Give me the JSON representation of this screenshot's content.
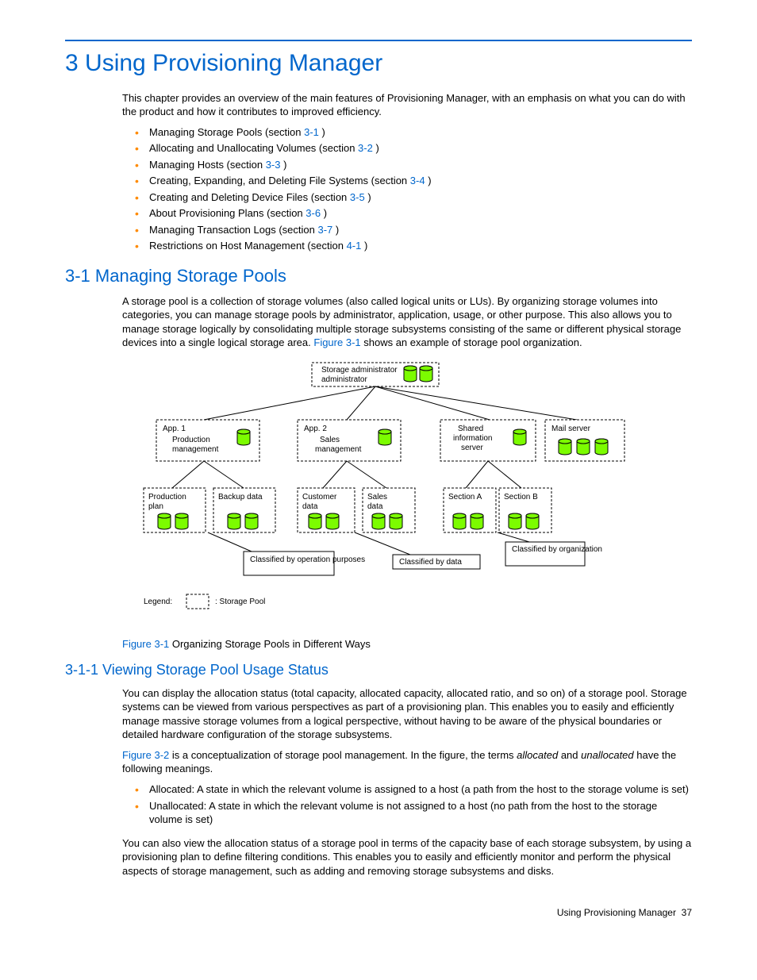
{
  "chapter": {
    "number": "3",
    "title": "Using Provisioning Manager"
  },
  "intro": "This chapter provides an overview of the main features of Provisioning Manager, with an emphasis on what you can do with the product and how it contributes to improved efficiency.",
  "toc": [
    {
      "text": "Managing Storage Pools (section ",
      "ref": "3-1",
      "tail": " )"
    },
    {
      "text": "Allocating and Unallocating Volumes (section ",
      "ref": "3-2",
      "tail": " )"
    },
    {
      "text": "Managing Hosts (section ",
      "ref": "3-3",
      "tail": " )"
    },
    {
      "text": "Creating, Expanding, and Deleting File Systems (section ",
      "ref": "3-4",
      "tail": " )"
    },
    {
      "text": "Creating and Deleting Device Files (section ",
      "ref": "3-5",
      "tail": " )"
    },
    {
      "text": "About Provisioning Plans (section ",
      "ref": "3-6",
      "tail": " )"
    },
    {
      "text": "Managing Transaction Logs (section ",
      "ref": "3-7",
      "tail": " )"
    },
    {
      "text": "Restrictions on Host Management (section ",
      "ref": "4-1",
      "tail": " )"
    }
  ],
  "s31": {
    "heading": "3-1 Managing Storage Pools",
    "p1a": "A storage pool is a collection of storage volumes (also called logical units or LUs). By organizing storage volumes into categories, you can manage storage pools by administrator, application, usage, or other purpose. This also allows you to manage storage logically by consolidating multiple storage subsystems consisting of the same or different physical storage devices into a single logical storage area. ",
    "p1ref": "Figure 3-1",
    "p1b": " shows an example of storage pool organization."
  },
  "diagram": {
    "top": "Storage administrator",
    "row2": [
      {
        "l1": "App. 1",
        "l2": "Production",
        "l3": "management"
      },
      {
        "l1": "App. 2",
        "l2": "Sales",
        "l3": "management"
      },
      {
        "l1": "Shared",
        "l2": "information",
        "l3": "server"
      },
      {
        "l1": "Mail server"
      }
    ],
    "row3": [
      {
        "l1": "Production",
        "l2": "plan"
      },
      {
        "l1": "Backup data"
      },
      {
        "l1": "Customer",
        "l2": "data"
      },
      {
        "l1": "Sales",
        "l2": "data"
      },
      {
        "l1": "Section A"
      },
      {
        "l1": "Section B"
      }
    ],
    "notes": {
      "left": "Classified by operation purposes",
      "mid": "Classified by data",
      "right": "Classified by organization"
    },
    "legend": {
      "label": "Legend:",
      "text": ": Storage Pool"
    }
  },
  "fig31": {
    "label": "Figure 3-1",
    "caption": " Organizing Storage Pools in Different Ways"
  },
  "s311": {
    "heading": "3-1-1 Viewing Storage Pool Usage Status",
    "p1": "You can display the allocation status (total capacity, allocated capacity, allocated ratio, and so on) of a storage pool. Storage systems can be viewed from various perspectives as part of a provisioning plan. This enables you to easily and efficiently manage massive storage volumes from a logical perspective, without having to be aware of the physical boundaries or detailed hardware configuration of the storage subsystems.",
    "p2ref": "Figure 3-2",
    "p2a": " is a conceptualization of storage pool management. In the figure, the terms ",
    "p2em1": "allocated",
    "p2b": " and ",
    "p2em2": "unallocated",
    "p2c": " have the following meanings.",
    "bullets": [
      "Allocated: A state in which the relevant volume is assigned to a host (a path from the host to the storage volume is set)",
      "Unallocated: A state in which the relevant volume is not assigned to a host (no path from the host to the storage volume is set)"
    ],
    "p3": "You can also view the allocation status of a storage pool in terms of the capacity base of each storage subsystem, by using a provisioning plan to define filtering conditions. This enables you to easily and efficiently monitor and perform the physical aspects of storage management, such as adding and removing storage subsystems and disks."
  },
  "footer": {
    "text": "Using Provisioning Manager",
    "page": "37"
  }
}
